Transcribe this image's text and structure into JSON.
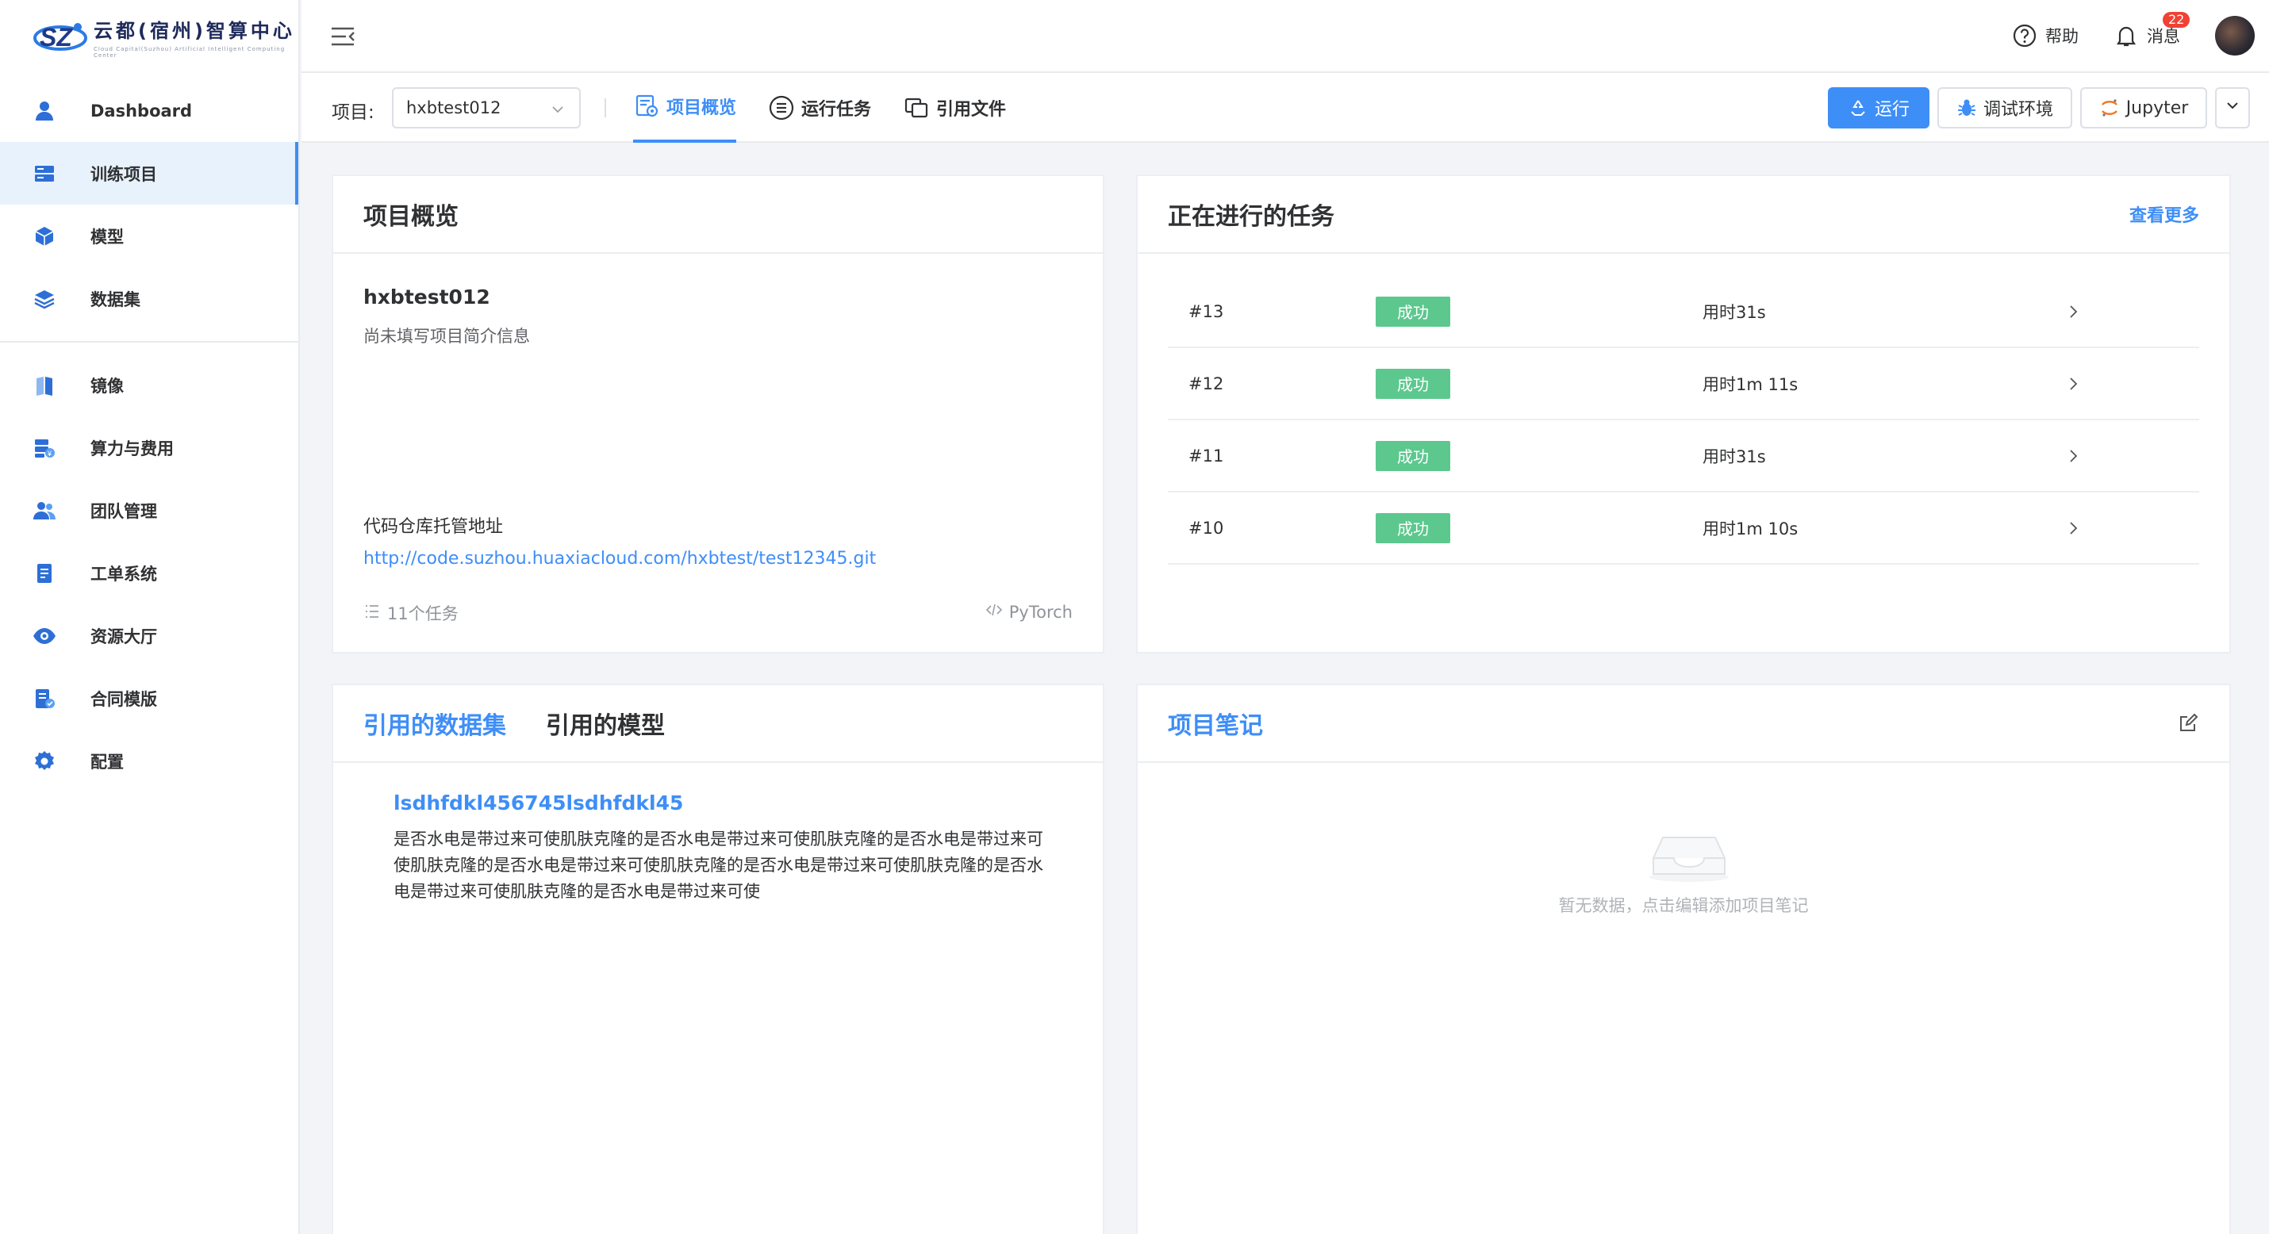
{
  "sidebar": {
    "logo_title": "云都(宿州)智算中心",
    "logo_subtitle": "Cloud Capital(Suzhou) Artificial Intelligent Computing Center",
    "items": [
      {
        "label": "Dashboard",
        "icon": "person-icon"
      },
      {
        "label": "训练项目",
        "icon": "server-icon",
        "active": true
      },
      {
        "label": "模型",
        "icon": "cube-icon"
      },
      {
        "label": "数据集",
        "icon": "layers-icon"
      },
      {
        "label": "镜像",
        "icon": "book-icon"
      },
      {
        "label": "算力与费用",
        "icon": "compute-billing-icon"
      },
      {
        "label": "团队管理",
        "icon": "team-icon"
      },
      {
        "label": "工单系统",
        "icon": "document-icon"
      },
      {
        "label": "资源大厅",
        "icon": "eye-icon"
      },
      {
        "label": "合同模版",
        "icon": "contract-icon"
      },
      {
        "label": "配置",
        "icon": "gear-icon"
      }
    ]
  },
  "header": {
    "help_label": "帮助",
    "messages_label": "消息",
    "messages_badge": "22"
  },
  "subheader": {
    "project_label": "项目:",
    "project_value": "hxbtest012",
    "tabs": [
      {
        "label": "项目概览",
        "active": true
      },
      {
        "label": "运行任务"
      },
      {
        "label": "引用文件"
      }
    ],
    "run_label": "运行",
    "debug_label": "调试环境",
    "jupyter_label": "Jupyter"
  },
  "overview": {
    "title": "项目概览",
    "name": "hxbtest012",
    "description": "尚未填写项目简介信息",
    "repo_label": "代码仓库托管地址",
    "repo_url": "http://code.suzhou.huaxiacloud.com/hxbtest/test12345.git",
    "task_count": "11个任务",
    "framework": "PyTorch"
  },
  "running_tasks": {
    "title": "正在进行的任务",
    "more_label": "查看更多",
    "rows": [
      {
        "id": "#13",
        "status": "成功",
        "time": "用时31s"
      },
      {
        "id": "#12",
        "status": "成功",
        "time": "用时1m 11s"
      },
      {
        "id": "#11",
        "status": "成功",
        "time": "用时31s"
      },
      {
        "id": "#10",
        "status": "成功",
        "time": "用时1m 10s"
      }
    ]
  },
  "references": {
    "tab_datasets": "引用的数据集",
    "tab_models": "引用的模型",
    "dataset_name": "lsdhfdkl456745lsdhfdkl45",
    "dataset_desc": "是否水电是带过来可使肌肤克隆的是否水电是带过来可使肌肤克隆的是否水电是带过来可使肌肤克隆的是否水电是带过来可使肌肤克隆的是否水电是带过来可使肌肤克隆的是否水电是带过来可使肌肤克隆的是否水电是带过来可使"
  },
  "notes": {
    "title": "项目笔记",
    "empty_text": "暂无数据，点击编辑添加项目笔记"
  },
  "colors": {
    "accent": "#3e8ef7",
    "success": "#5cc88e",
    "badge": "#f04134"
  }
}
